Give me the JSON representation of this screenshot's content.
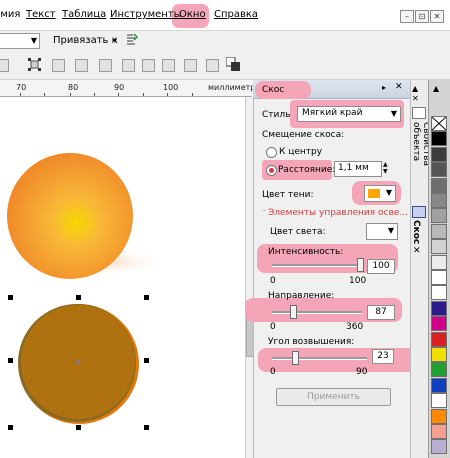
{
  "menubar": {
    "items": [
      {
        "label": "рмия"
      },
      {
        "label": "Текст"
      },
      {
        "label": "Таблица"
      },
      {
        "label": "Инструменты"
      },
      {
        "label": "Окно"
      },
      {
        "label": "Справка"
      }
    ],
    "window_buttons": [
      "–",
      "⊡",
      "✕"
    ]
  },
  "toolbar": {
    "snap_label": "Привязать к",
    "snap_arrow": "▾"
  },
  "ruler": {
    "numbers": [
      "70",
      "80",
      "90",
      "100"
    ],
    "unit": "миллиметр"
  },
  "docker": {
    "title": "Скос",
    "style_label": "Стиль:",
    "style_value": "Мягкий край",
    "offset_label": "Смещение скоса:",
    "to_center_label": "К центру",
    "distance_label": "Расстояние:",
    "distance_value": "1,1 мм",
    "shadow_color_label": "Цвет тени:",
    "lighting_section": "Элементы управления осве...",
    "light_color_label": "Цвет света:",
    "intensity_label": "Интенсивность:",
    "intensity_value": "100",
    "intensity_min": "0",
    "intensity_max": "100",
    "direction_label": "Направление:",
    "direction_value": "87",
    "direction_min": "0",
    "direction_max": "360",
    "elevation_label": "Угол возвышения:",
    "elevation_value": "23",
    "elevation_min": "0",
    "elevation_max": "90",
    "apply_label": "Применить",
    "shadow_color": "#ffa500",
    "light_color": "#ffffff"
  },
  "side_tabs": {
    "tab1": "Свойства объекта",
    "tab2": "Скос"
  },
  "palette_colors": [
    "#ffffff",
    "#000000",
    "#3c3c3c",
    "#555555",
    "#6e6e6e",
    "#878787",
    "#a0a0a0",
    "#b9b9b9",
    "#d2d2d2",
    "#ebebeb",
    "#ffffff",
    "#ffffff",
    "#2a1a8a",
    "#d0008a",
    "#d82020",
    "#f0e000",
    "#20a030",
    "#1040c0",
    "#ffffff",
    "#ff8a00",
    "#f6a090",
    "#b8b0d0"
  ],
  "accent_highlight": "#f4a6b8"
}
